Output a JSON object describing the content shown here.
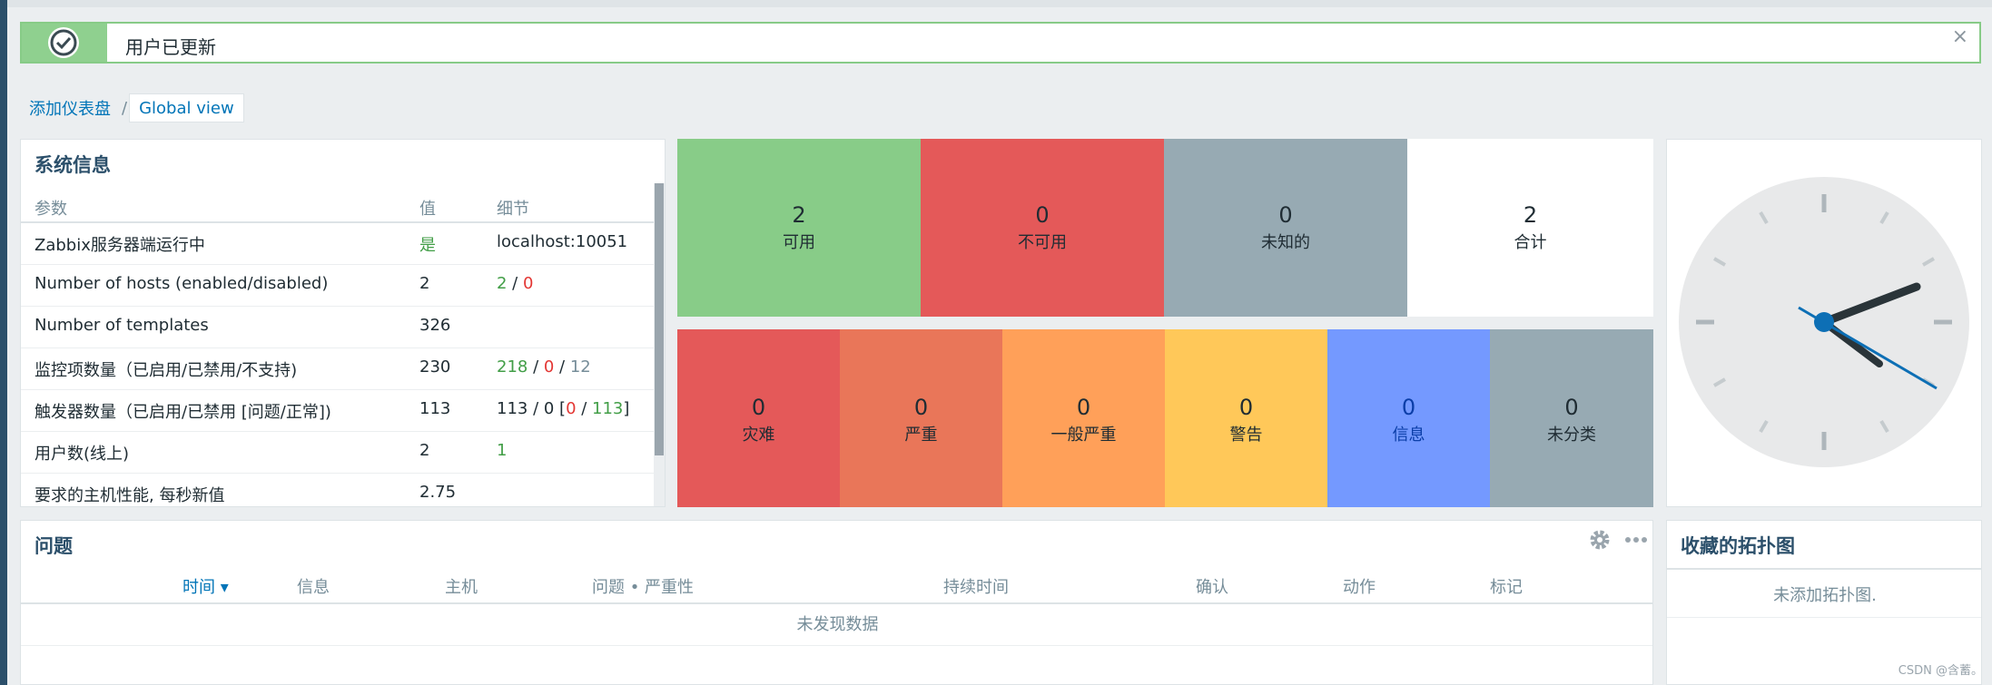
{
  "message": {
    "text": "用户已更新",
    "close": "×",
    "color": "#87cb87"
  },
  "breadcrumb": {
    "items": [
      "添加仪表盘",
      "/",
      "Global view"
    ]
  },
  "system_info": {
    "title": "系统信息",
    "headers": [
      "参数",
      "值",
      "细节"
    ],
    "rows": [
      {
        "param": "Zabbix服务器端运行中",
        "value": "是",
        "detail": "localhost:10051"
      },
      {
        "param": "Number of hosts (enabled/disabled)",
        "value": "2",
        "detail_parts": [
          "2",
          " / ",
          "0"
        ]
      },
      {
        "param": "Number of templates",
        "value": "326",
        "detail": ""
      },
      {
        "param": "监控项数量（已启用/已禁用/不支持)",
        "value": "230",
        "detail_parts": [
          "218",
          " / ",
          "0",
          " / ",
          "12"
        ]
      },
      {
        "param": "触发器数量（已启用/已禁用 [问题/正常])",
        "value": "113",
        "detail_parts": [
          "113 / 0 [",
          "0",
          " / ",
          "113",
          "]"
        ]
      },
      {
        "param": "用户数(线上)",
        "value": "2",
        "detail": "1"
      },
      {
        "param": "要求的主机性能, 每秒新值",
        "value": "2.75",
        "detail": ""
      }
    ]
  },
  "host_availability": {
    "cells": [
      {
        "count": "2",
        "label": "可用",
        "color": "#88cc88"
      },
      {
        "count": "0",
        "label": "不可用",
        "color": "#e45959"
      },
      {
        "count": "0",
        "label": "未知的",
        "color": "#97aab3"
      },
      {
        "count": "2",
        "label": "合计",
        "color": "#ffffff"
      }
    ]
  },
  "problems_by_severity": {
    "cells": [
      {
        "count": "0",
        "label": "灾难",
        "color": "#e45959"
      },
      {
        "count": "0",
        "label": "严重",
        "color": "#e97659"
      },
      {
        "count": "0",
        "label": "一般严重",
        "color": "#ffa059"
      },
      {
        "count": "0",
        "label": "警告",
        "color": "#ffc859"
      },
      {
        "count": "0",
        "label": "信息",
        "color": "#7499ff"
      },
      {
        "count": "0",
        "label": "未分类",
        "color": "#97aab3"
      }
    ]
  },
  "problems": {
    "title": "问题",
    "headers": [
      "时间 ▾",
      "信息",
      "主机",
      "问题 • 严重性",
      "持续时间",
      "确认",
      "动作",
      "标记"
    ],
    "empty": "未发现数据"
  },
  "favorite_maps": {
    "title": "收藏的拓扑图",
    "empty": "未添加拓扑图."
  },
  "watermark": "CSDN @含蓄。"
}
